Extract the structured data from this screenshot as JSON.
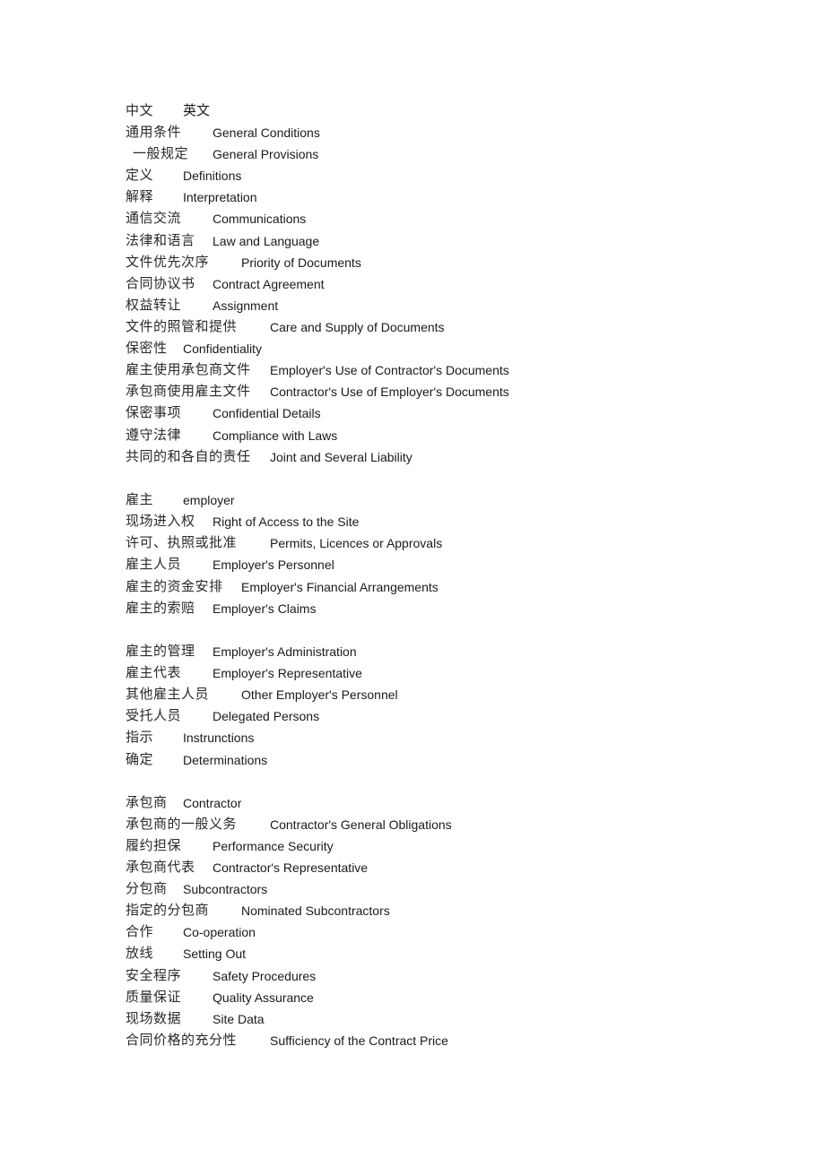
{
  "document": {
    "sections": [
      {
        "rows": [
          {
            "zh": "中文",
            "en": "英文"
          },
          {
            "zh": "通用条件",
            "en": "General Conditions"
          },
          {
            "zh": "一般规定",
            "en": "General Provisions"
          },
          {
            "zh": "定义",
            "en": "Definitions"
          },
          {
            "zh": "解释",
            "en": "Interpretation"
          },
          {
            "zh": "通信交流",
            "en": "Communications"
          },
          {
            "zh": "法律和语言",
            "en": "Law and Language"
          },
          {
            "zh": "文件优先次序",
            "en": "Priority of Documents"
          },
          {
            "zh": "合同协议书",
            "en": "Contract Agreement"
          },
          {
            "zh": "权益转让",
            "en": "Assignment"
          },
          {
            "zh": "文件的照管和提供",
            "en": "Care and Supply of Documents"
          },
          {
            "zh": "保密性",
            "en": "Confidentiality"
          },
          {
            "zh": "雇主使用承包商文件",
            "en": "Employer's Use of Contractor's Documents"
          },
          {
            "zh": "承包商使用雇主文件",
            "en": "Contractor's Use of Employer's Documents"
          },
          {
            "zh": "保密事项",
            "en": "Confidential Details"
          },
          {
            "zh": "遵守法律",
            "en": "Compliance with Laws"
          },
          {
            "zh": "共同的和各自的责任",
            "en": "Joint and Several Liability"
          }
        ]
      },
      {
        "rows": [
          {
            "zh": "雇主",
            "en": "employer"
          },
          {
            "zh": "现场进入权",
            "en": "Right of Access to the Site"
          },
          {
            "zh": "许可、执照或批准",
            "en": "Permits, Licences or Approvals"
          },
          {
            "zh": "雇主人员",
            "en": "Employer's Personnel"
          },
          {
            "zh": "雇主的资金安排",
            "en": "Employer's Financial Arrangements"
          },
          {
            "zh": "雇主的索赔",
            "en": "Employer's Claims"
          }
        ]
      },
      {
        "rows": [
          {
            "zh": "雇主的管理",
            "en": "Employer's Administration"
          },
          {
            "zh": "雇主代表",
            "en": "Employer's Representative"
          },
          {
            "zh": "其他雇主人员",
            "en": "Other Employer's Personnel"
          },
          {
            "zh": "受托人员",
            "en": "Delegated Persons"
          },
          {
            "zh": "指示",
            "en": "Instrunctions"
          },
          {
            "zh": "确定",
            "en": "Determinations"
          }
        ]
      },
      {
        "rows": [
          {
            "zh": "承包商",
            "en": "Contractor"
          },
          {
            "zh": "承包商的一般义务",
            "en": "Contractor's General Obligations"
          },
          {
            "zh": "履约担保",
            "en": "Performance Security"
          },
          {
            "zh": "承包商代表",
            "en": "Contractor's Representative"
          },
          {
            "zh": "分包商",
            "en": "Subcontractors"
          },
          {
            "zh": "指定的分包商",
            "en": "Nominated Subcontractors"
          },
          {
            "zh": "合作",
            "en": "Co-operation"
          },
          {
            "zh": "放线",
            "en": "Setting Out"
          },
          {
            "zh": "安全程序",
            "en": "Safety Procedures"
          },
          {
            "zh": "质量保证",
            "en": "Quality Assurance"
          },
          {
            "zh": "现场数据",
            "en": "Site Data"
          },
          {
            "zh": "合同价格的充分性",
            "en": "Sufficiency of the Contract Price"
          }
        ]
      }
    ]
  }
}
